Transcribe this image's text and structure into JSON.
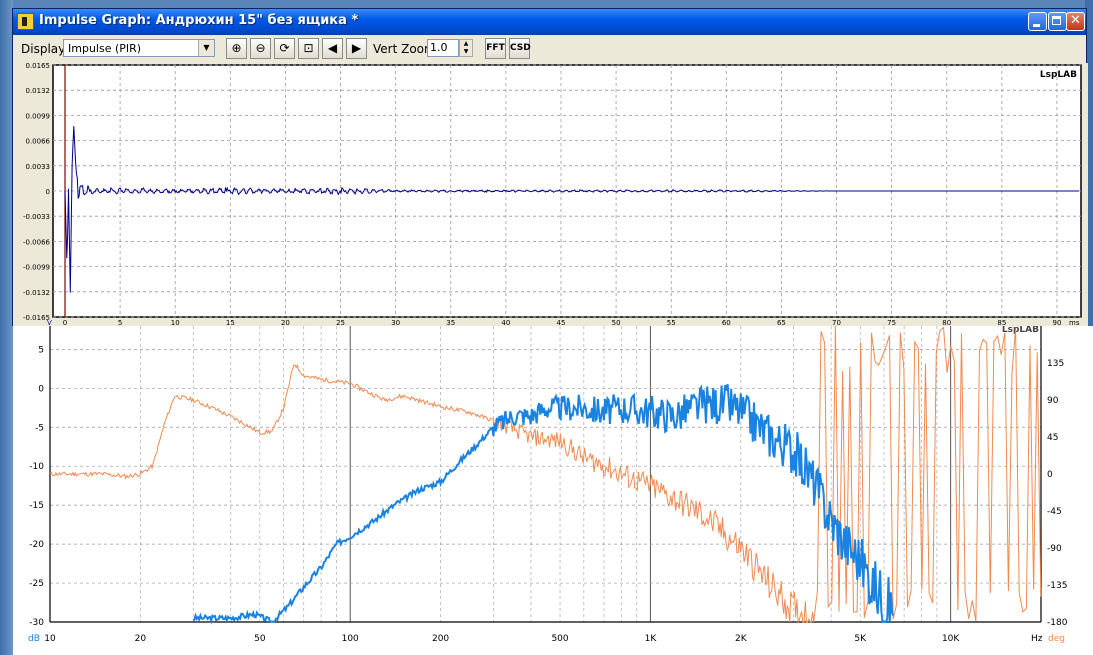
{
  "window": {
    "title": "Impulse Graph: Андрюхин 15\" без ящика *"
  },
  "toolbar": {
    "display_label": "Display",
    "display_value": "Impulse (PIR)",
    "vert_zoom_label": "Vert Zoom",
    "vert_zoom_value": "1.0",
    "fft_label": "FFT",
    "csd_label": "CSD"
  },
  "impulse_graph": {
    "logo": "LspLAB",
    "y_ticks": [
      "0.0165",
      "0.0132",
      "0.0099",
      "0.0066",
      "0.0033",
      "0",
      "-0.0033",
      "-0.0066",
      "-0.0099",
      "-0.0132",
      "-0.0165"
    ],
    "x_ticks": [
      "0",
      "5",
      "10",
      "15",
      "20",
      "25",
      "30",
      "35",
      "40",
      "45",
      "50",
      "55",
      "60",
      "65",
      "70",
      "75",
      "80",
      "85",
      "90"
    ],
    "y_unit": "V",
    "x_unit": "ms",
    "line_color": "#00008b"
  },
  "freq_graph": {
    "logo": "LspLAB",
    "db_ticks": [
      "5",
      "0",
      "-5",
      "-10",
      "-15",
      "-20",
      "-25",
      "-30"
    ],
    "deg_ticks": [
      "135",
      "90",
      "45",
      "0",
      "-45",
      "-90",
      "-135",
      "-180"
    ],
    "x_ticks": [
      "10",
      "20",
      "50",
      "100",
      "200",
      "500",
      "1K",
      "2K",
      "5K",
      "10K"
    ],
    "db_unit": "dB",
    "hz_unit": "Hz",
    "deg_unit": "deg",
    "magnitude_color": "#1a82e0",
    "phase_color": "#f08a50"
  },
  "chart_data": [
    {
      "type": "line",
      "title": "",
      "xlabel": "ms",
      "ylabel": "V",
      "xlim": [
        0,
        92
      ],
      "ylim": [
        -0.0165,
        0.0165
      ],
      "series": [
        {
          "name": "",
          "x": [
            0,
            0.2,
            0.3,
            0.5,
            0.6,
            0.8,
            1.0,
            1.2,
            1.5,
            2,
            3,
            5,
            10,
            15,
            20,
            25,
            30,
            40,
            50,
            60,
            70,
            80,
            92
          ],
          "values": [
            0,
            -0.011,
            0.002,
            -0.015,
            0.002,
            0.0085,
            0.0025,
            0.0012,
            0.0008,
            0.0005,
            0.0002,
            0.0003,
            0.0002,
            0.0003,
            0.0002,
            0.0003,
            0.0001,
            0.0001,
            0.0001,
            0.0001,
            0,
            0,
            0
          ]
        }
      ]
    },
    {
      "type": "line",
      "title": "",
      "xlabel": "Hz",
      "ylabel": "dB",
      "xscale": "log",
      "xlim": [
        10,
        20000
      ],
      "ylim": [
        -30,
        8
      ],
      "y2lim": [
        -180,
        180
      ],
      "series": [
        {
          "name": "",
          "axis": "dB",
          "x": [
            30,
            40,
            48,
            55,
            62,
            70,
            80,
            90,
            100,
            120,
            140,
            170,
            200,
            230,
            260,
            300,
            350,
            400,
            450,
            500,
            600,
            700,
            800,
            1000,
            1200,
            1500,
            1800,
            2000,
            2500,
            3000,
            3500,
            4000,
            4500,
            5000,
            5500,
            6000,
            6500
          ],
          "values": [
            -29.5,
            -29.5,
            -29,
            -30,
            -28,
            -25.5,
            -23,
            -20,
            -19,
            -17,
            -15,
            -13,
            -12,
            -9.5,
            -7.5,
            -5,
            -3.5,
            -3.5,
            -2.5,
            -2.5,
            -2.5,
            -3,
            -2.5,
            -3,
            -3.5,
            -2,
            -2,
            -3,
            -6,
            -8,
            -12,
            -17,
            -20,
            -22,
            -25,
            -27,
            -29
          ]
        },
        {
          "name": "",
          "axis": "deg",
          "x": [
            10,
            15,
            18,
            20,
            22,
            24,
            26,
            30,
            35,
            40,
            45,
            50,
            55,
            60,
            65,
            70,
            80,
            100,
            130,
            150,
            200,
            250,
            300,
            400,
            500,
            600,
            700,
            800,
            1000,
            1200,
            1500,
            2000,
            2500,
            3000,
            3500
          ],
          "values": [
            0,
            0,
            -3,
            0,
            10,
            60,
            95,
            90,
            80,
            70,
            60,
            50,
            52,
            80,
            135,
            120,
            115,
            110,
            90,
            95,
            82,
            75,
            65,
            45,
            40,
            20,
            10,
            0,
            -15,
            -30,
            -50,
            -90,
            -135,
            -165,
            -175
          ]
        }
      ]
    }
  ]
}
